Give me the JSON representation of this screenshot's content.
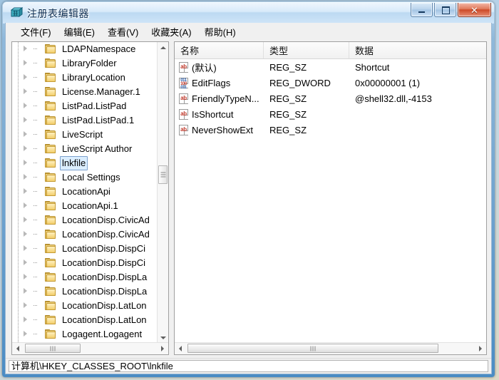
{
  "window": {
    "title": "注册表编辑器",
    "app_icon": "registry-editor-icon",
    "buttons": {
      "minimize": "minimize-icon",
      "maximize": "maximize-icon",
      "close": "✕"
    }
  },
  "menubar": {
    "items": [
      {
        "label": "文件(F)",
        "name": "menu-file"
      },
      {
        "label": "编辑(E)",
        "name": "menu-edit"
      },
      {
        "label": "查看(V)",
        "name": "menu-view"
      },
      {
        "label": "收藏夹(A)",
        "name": "menu-favorites"
      },
      {
        "label": "帮助(H)",
        "name": "menu-help"
      }
    ]
  },
  "tree": {
    "items": [
      {
        "label": "LDAPNamespace",
        "selected": false
      },
      {
        "label": "LibraryFolder",
        "selected": false
      },
      {
        "label": "LibraryLocation",
        "selected": false
      },
      {
        "label": "License.Manager.1",
        "selected": false
      },
      {
        "label": "ListPad.ListPad",
        "selected": false
      },
      {
        "label": "ListPad.ListPad.1",
        "selected": false
      },
      {
        "label": "LiveScript",
        "selected": false
      },
      {
        "label": "LiveScript Author",
        "selected": false
      },
      {
        "label": "lnkfile",
        "selected": true
      },
      {
        "label": "Local Settings",
        "selected": false
      },
      {
        "label": "LocationApi",
        "selected": false
      },
      {
        "label": "LocationApi.1",
        "selected": false
      },
      {
        "label": "LocationDisp.CivicAd",
        "selected": false
      },
      {
        "label": "LocationDisp.CivicAd",
        "selected": false
      },
      {
        "label": "LocationDisp.DispCi",
        "selected": false
      },
      {
        "label": "LocationDisp.DispCi",
        "selected": false
      },
      {
        "label": "LocationDisp.DispLa",
        "selected": false
      },
      {
        "label": "LocationDisp.DispLa",
        "selected": false
      },
      {
        "label": "LocationDisp.LatLon",
        "selected": false
      },
      {
        "label": "LocationDisp.LatLon",
        "selected": false
      },
      {
        "label": "Logagent.Logagent",
        "selected": false
      }
    ]
  },
  "list": {
    "columns": [
      {
        "label": "名称",
        "name": "column-name"
      },
      {
        "label": "类型",
        "name": "column-type"
      },
      {
        "label": "数据",
        "name": "column-data"
      }
    ],
    "rows": [
      {
        "icon": "string-value-icon",
        "name": "(默认)",
        "type": "REG_SZ",
        "data": "Shortcut"
      },
      {
        "icon": "dword-value-icon",
        "name": "EditFlags",
        "type": "REG_DWORD",
        "data": "0x00000001 (1)"
      },
      {
        "icon": "string-value-icon",
        "name": "FriendlyTypeN...",
        "type": "REG_SZ",
        "data": "@shell32.dll,-4153"
      },
      {
        "icon": "string-value-icon",
        "name": "IsShortcut",
        "type": "REG_SZ",
        "data": ""
      },
      {
        "icon": "string-value-icon",
        "name": "NeverShowExt",
        "type": "REG_SZ",
        "data": ""
      }
    ]
  },
  "statusbar": {
    "path": "计算机\\HKEY_CLASSES_ROOT\\lnkfile"
  },
  "colors": {
    "accent": "#4a8cc4",
    "selection": "#dbeeff",
    "selection_border": "#7da2ce",
    "close_button": "#cd4a28"
  }
}
